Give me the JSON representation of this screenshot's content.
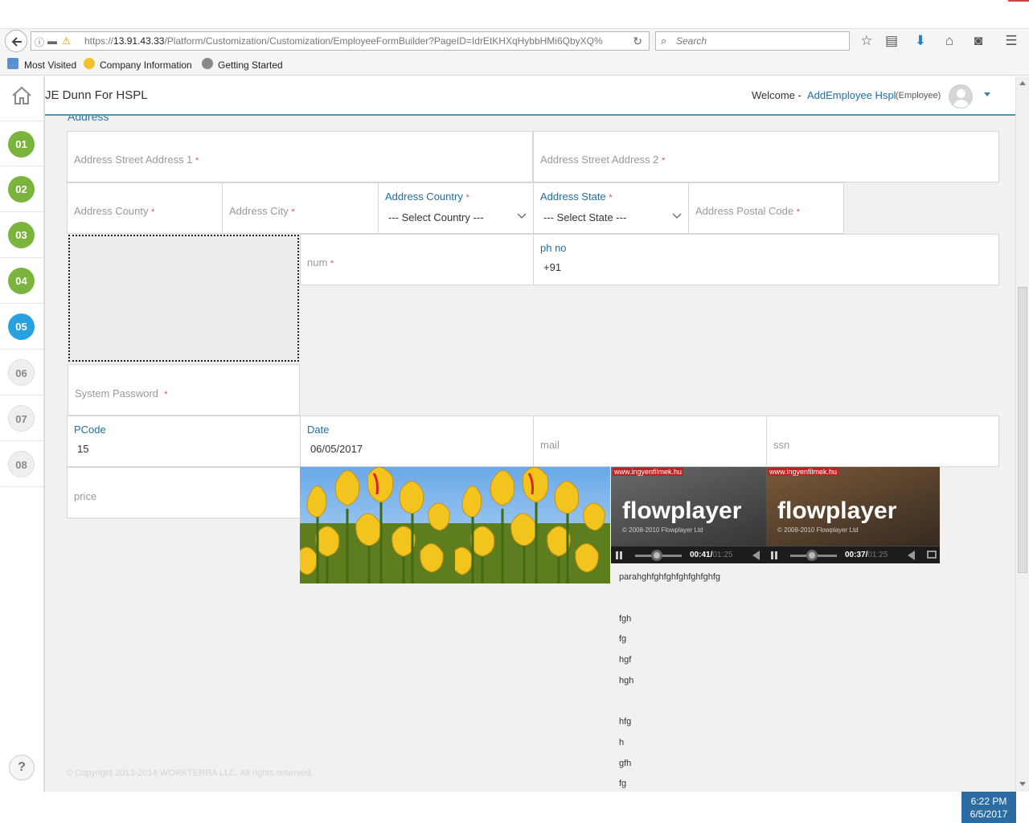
{
  "browser": {
    "url_prefix": "https://",
    "url_host": "13.91.43.33",
    "url_path": "/Platform/Customization/Customization/EmployeeFormBuilder?PageID=IdrEtKHXqHybbHMi6QbyXQ%",
    "search_placeholder": "Search",
    "bookmarks": [
      {
        "label": "Most Visited"
      },
      {
        "label": "Company Information"
      },
      {
        "label": "Getting Started"
      }
    ]
  },
  "header": {
    "company": "JE Dunn For HSPL",
    "welcome": "Welcome -",
    "user_name": "AddEmployee Hspl",
    "user_role": "(Employee)"
  },
  "steps": [
    "01",
    "02",
    "03",
    "04",
    "05",
    "06",
    "07",
    "08"
  ],
  "active_step": "05",
  "help": "?",
  "form": {
    "section_title": "Address",
    "street1": "Address Street Address 1",
    "street2": "Address Street Address 2",
    "county": "Address County",
    "city": "Address City",
    "country_label": "Address Country",
    "country_value": "--- Select Country ---",
    "state_label": "Address State",
    "state_value": "--- Select State ---",
    "postal": "Address Postal Code",
    "num": "num",
    "phone_label": "ph no",
    "phone_value": "+91",
    "password": "System Password",
    "pcode_label": "PCode",
    "pcode_value": "15",
    "date_label": "Date",
    "date_value": "06/05/2017",
    "mail": "mail",
    "ssn": "ssn",
    "price": "price",
    "required_mark": "*"
  },
  "media": {
    "players": [
      {
        "site": "www.ingyenfilmek.hu",
        "brand": "flowplayer",
        "copyright": "© 2008-2010 Flowplayer Ltd",
        "time": "00:41/",
        "duration": "01:25"
      },
      {
        "site": "www.ingyenfilmek.hu",
        "brand": "flowplayer",
        "copyright": "© 2008-2010 Flowplayer Ltd",
        "time": "00:37/",
        "duration": "01:25"
      }
    ],
    "paragraph_lines": [
      "parahghfghfghfghfghfghfg",
      "",
      "fgh",
      "fg",
      "hgf",
      "hgh",
      "",
      "hfg",
      "h",
      "gfh",
      "fg"
    ]
  },
  "footer": "© Copyright 2013-2014 WORKTERRA LLC. All rights reserved.",
  "taskbar": {
    "time": "6:22 PM",
    "date": "6/5/2017"
  }
}
